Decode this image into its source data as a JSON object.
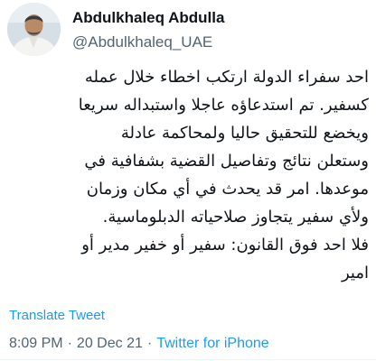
{
  "tweet": {
    "author": {
      "display_name": "Abdulkhaleq Abdulla",
      "handle": "@Abdulkhaleq_UAE",
      "avatar_icon": "profile-photo"
    },
    "text_lines": [
      "احد سفراء الدولة ارتكب اخطاء خلال عمله",
      "كسفير. تم استدعاؤه عاجلا واستبداله سريعا",
      "ويخضع للتحقيق حاليا ولمحاكمة عادلة",
      "وستعلن نتائج وتفاصيل القضية بشفافية في",
      "موعدها. امر قد يحدث في أي مكان وزمان",
      "ولأي سفير يتجاوز صلاحياته الدبلوماسية.",
      "فلا احد فوق القانون: سفير أو خفير مدير أو",
      "امير"
    ],
    "translate_label": "Translate Tweet",
    "time": "8:09 PM",
    "separator": "·",
    "date": "20 Dec 21",
    "source": "Twitter for iPhone"
  },
  "colors": {
    "text_primary": "#0f1419",
    "text_secondary": "#536471",
    "link": "#1d9bf0"
  }
}
